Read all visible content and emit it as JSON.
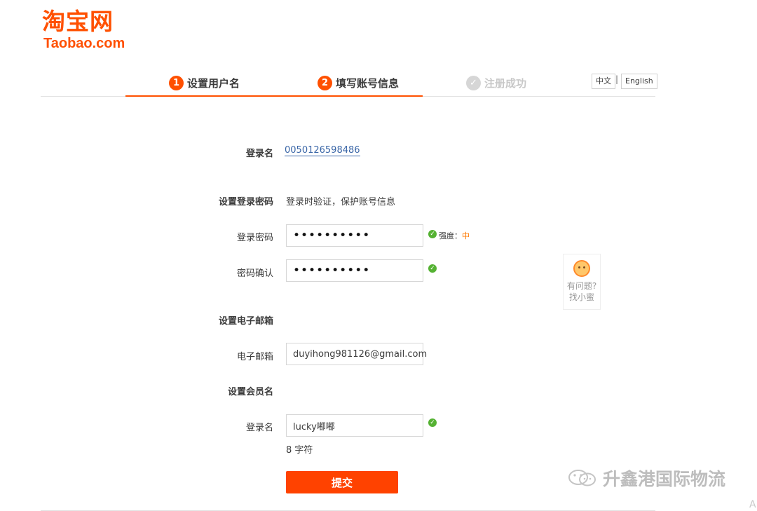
{
  "logo": {
    "cn": "淘宝网",
    "en": "Taobao.com"
  },
  "steps": [
    {
      "num": "1",
      "label": "设置用户名"
    },
    {
      "num": "2",
      "label": "填写账号信息"
    },
    {
      "label": "注册成功"
    }
  ],
  "lang": {
    "cn": "中文",
    "sep": "|",
    "en": "English"
  },
  "form": {
    "login_name_label": "登录名",
    "login_name_value": "0050126598486",
    "password_section": "设置登录密码",
    "password_hint": "登录时验证，保护账号信息",
    "password_label": "登录密码",
    "password_value": "••••••••••",
    "strength_label": "强度：",
    "strength_level": "中",
    "confirm_label": "密码确认",
    "confirm_value": "••••••••••",
    "email_section": "设置电子邮箱",
    "email_label": "电子邮箱",
    "email_value": "duyihong981126@gmail.com",
    "member_section": "设置会员名",
    "member_label": "登录名",
    "member_value": "lucky嘟嘟",
    "member_count": "8 字符",
    "submit_label": "提交"
  },
  "help": {
    "line1": "有问题?",
    "line2": "找小蜜"
  },
  "watermark": {
    "text": "升鑫港国际物流",
    "corner": "A"
  },
  "colors": {
    "brand": "#ff5000",
    "submit": "#ff4200",
    "ok": "#55b233",
    "link": "#3a66a7"
  }
}
